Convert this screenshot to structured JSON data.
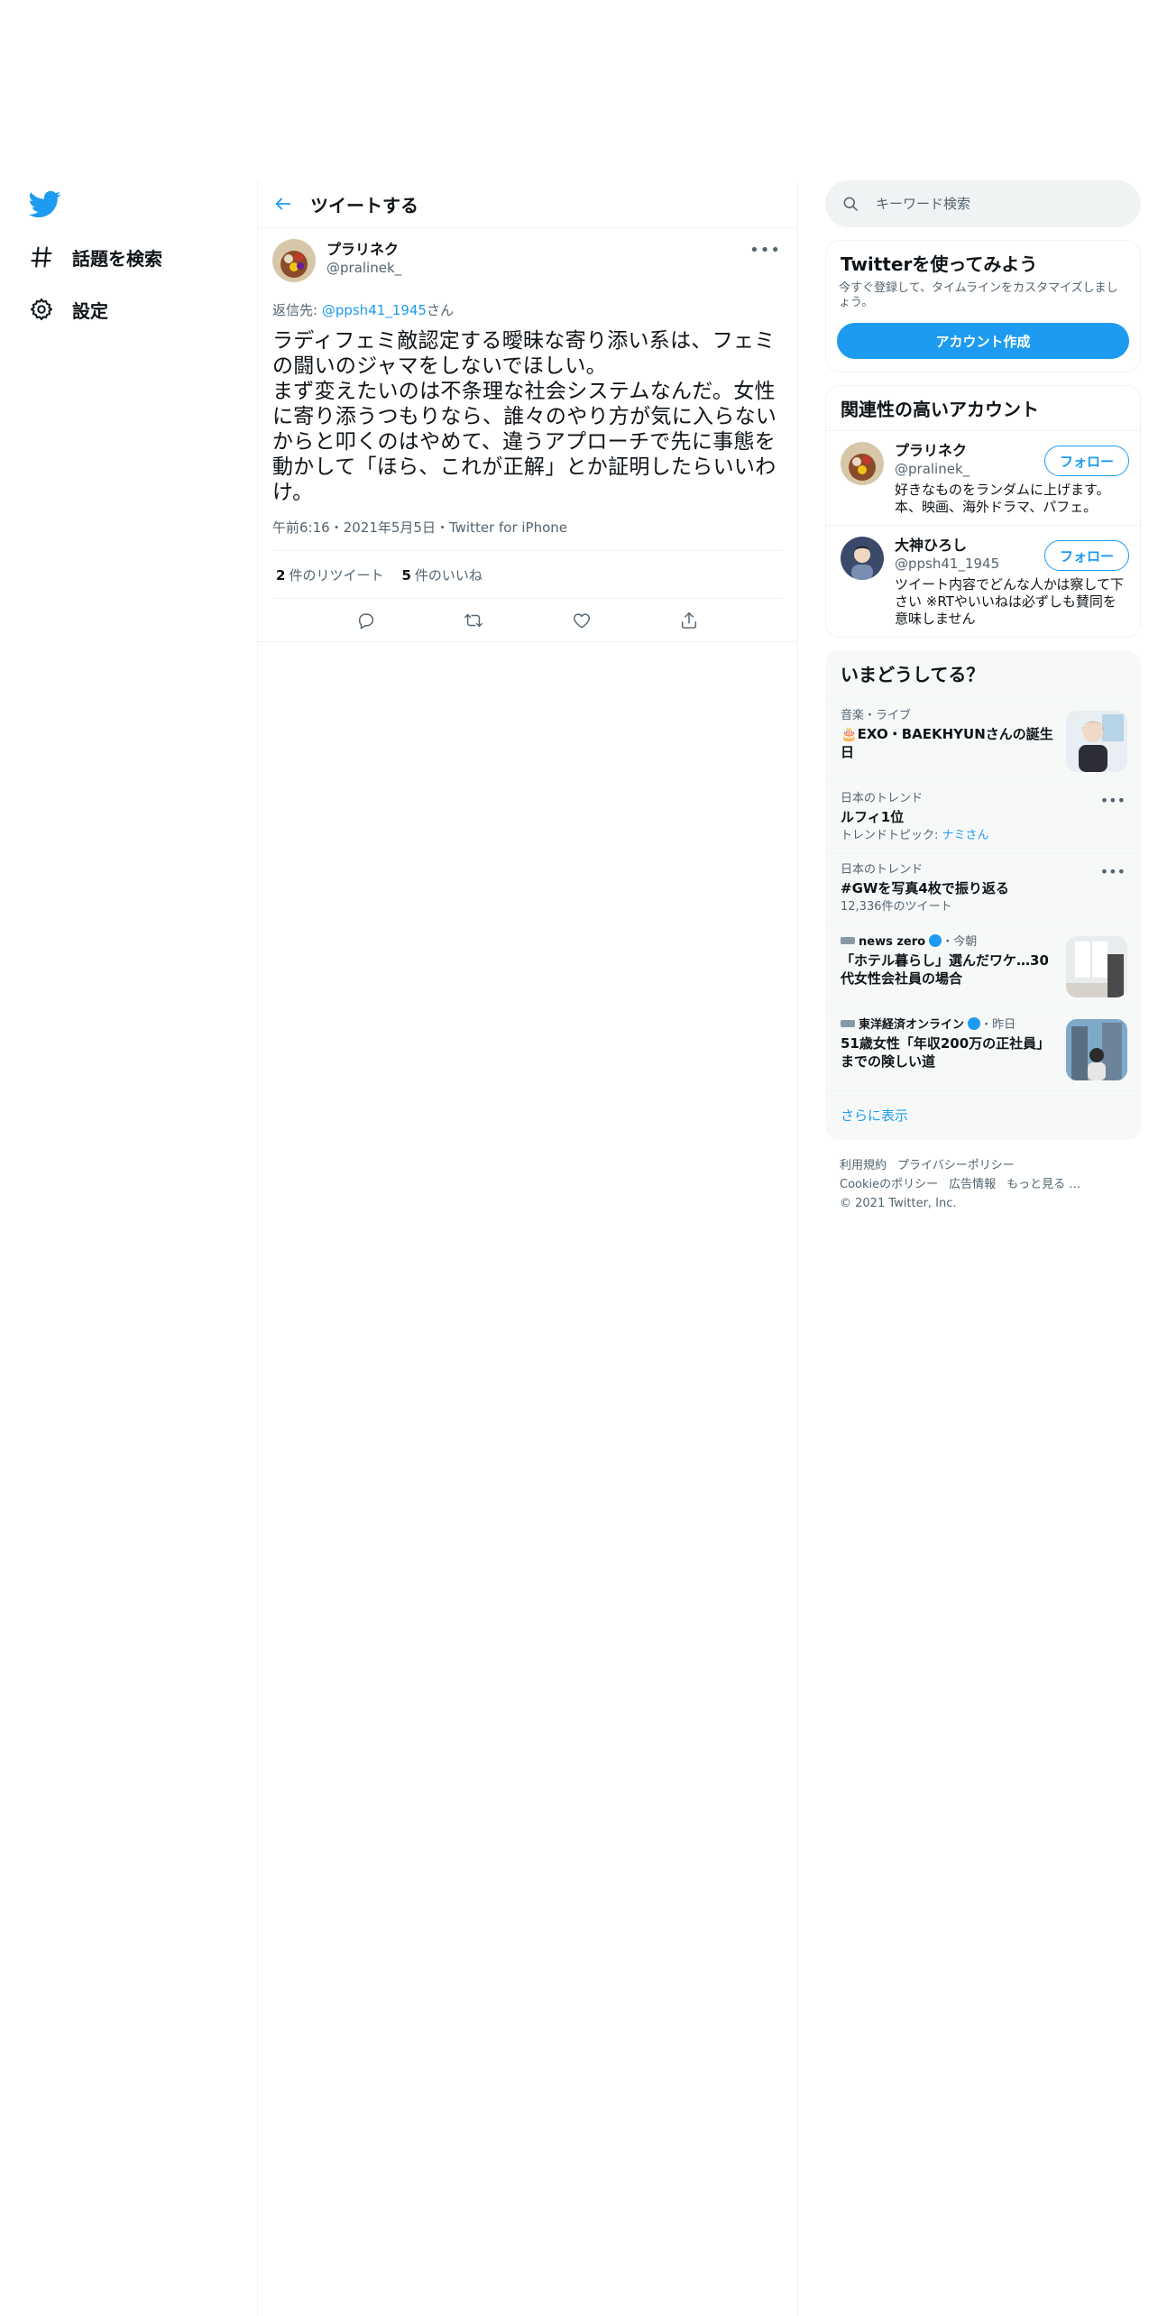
{
  "nav": {
    "logo_icon": "twitter-bird-icon",
    "items": [
      {
        "label": "話題を検索",
        "icon": "hashtag-icon"
      },
      {
        "label": "設定",
        "icon": "gear-icon"
      }
    ]
  },
  "main": {
    "header_title": "ツイートする",
    "tweet": {
      "author_name": "プラリネク",
      "author_handle": "@pralinek_",
      "reply_prefix": "返信先: ",
      "reply_mention": "@ppsh41_1945",
      "reply_suffix": "さん",
      "text": "ラディフェミ敵認定する曖昧な寄り添い系は、フェミの闘いのジャマをしないでほしい。\nまず変えたいのは不条理な社会システムなんだ。女性に寄り添うつもりなら、誰々のやり方が気に入らないからと叩くのはやめて、違うアプローチで先に事態を動かして「ほら、これが正解」とか証明したらいいわけ。",
      "meta": "午前6:16・2021年5月5日・Twitter for iPhone",
      "retweet_count": "2",
      "retweet_label": "件のリツイート",
      "like_count": "5",
      "like_label": "件のいいね"
    }
  },
  "right": {
    "search_placeholder": "キーワード検索",
    "signup": {
      "title": "Twitterを使ってみよう",
      "desc": "今すぐ登録して、タイムラインをカスタマイズしましょう。",
      "button": "アカウント作成"
    },
    "accounts": {
      "title": "関連性の高いアカウント",
      "items": [
        {
          "name": "プラリネク",
          "handle": "@pralinek_",
          "bio": "好きなものをランダムに上げます。本、映画、海外ドラマ、パフェ。",
          "follow": "フォロー"
        },
        {
          "name": "大神ひろし",
          "handle": "@ppsh41_1945",
          "bio": "ツイート内容でどんな人かは察して下さい ※RTやいいねは必ずしも賛同を意味しません",
          "follow": "フォロー"
        }
      ]
    },
    "trends": {
      "title": "いまどうしてる？",
      "items": [
        {
          "context": "音楽・ライブ",
          "title": "🎂EXO・BAEKHYUNさんの誕生日"
        },
        {
          "context": "日本のトレンド",
          "title": "ルフィ1位",
          "sub_prefix": "トレンドトピック: ",
          "sub_link": "ナミさん"
        },
        {
          "context": "日本のトレンド",
          "title": "#GWを写真4枚で振り返る",
          "sub": "12,336件のツイート"
        },
        {
          "source": "news zero",
          "time": "・今朝",
          "title": "「ホテル暮らし」選んだワケ…30代女性会社員の場合"
        },
        {
          "source": "東洋経済オンライン",
          "time": "・昨日",
          "title": "51歳女性「年収200万の正社員」までの険しい道"
        }
      ],
      "show_more": "さらに表示"
    },
    "footer": {
      "links": [
        "利用規約",
        "プライバシーポリシー",
        "Cookieのポリシー",
        "広告情報",
        "もっと見る …"
      ],
      "copyright": "© 2021 Twitter, Inc."
    }
  },
  "colors": {
    "accent": "#1d9bf0",
    "text": "#0f1419",
    "muted": "#536471",
    "border": "#eff3f4",
    "panel": "#f7f9f9"
  }
}
